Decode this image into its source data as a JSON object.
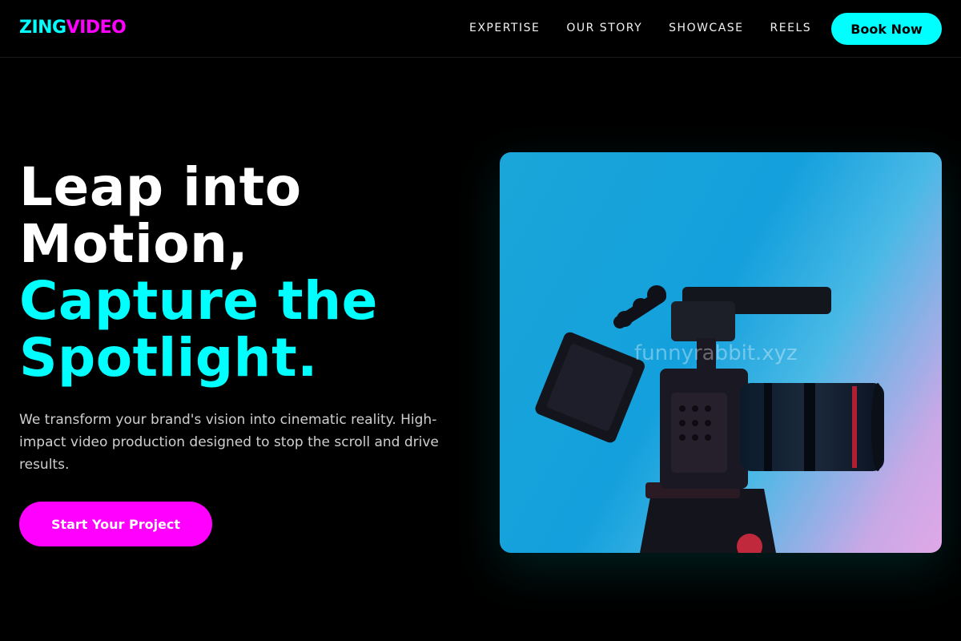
{
  "brand": {
    "part1": "ZING",
    "part2": "VIDEO"
  },
  "nav": {
    "items": [
      "EXPERTISE",
      "OUR STORY",
      "SHOWCASE",
      "REELS"
    ],
    "cta_label": "Book Now"
  },
  "hero": {
    "title_line1": "Leap into",
    "title_line2": "Motion,",
    "title_line3": "Capture the",
    "title_line4": "Spotlight.",
    "subtitle": "We transform your brand's vision into cinematic reality. High-impact video production designed to stop the scroll and drive results.",
    "cta_label": "Start Your Project",
    "image_watermark": "funnyrabbit.xyz"
  },
  "colors": {
    "accent_cyan": "#00ffff",
    "accent_magenta": "#ff00ff",
    "background": "#000000"
  },
  "icons": [
    "camera-rig-image"
  ]
}
